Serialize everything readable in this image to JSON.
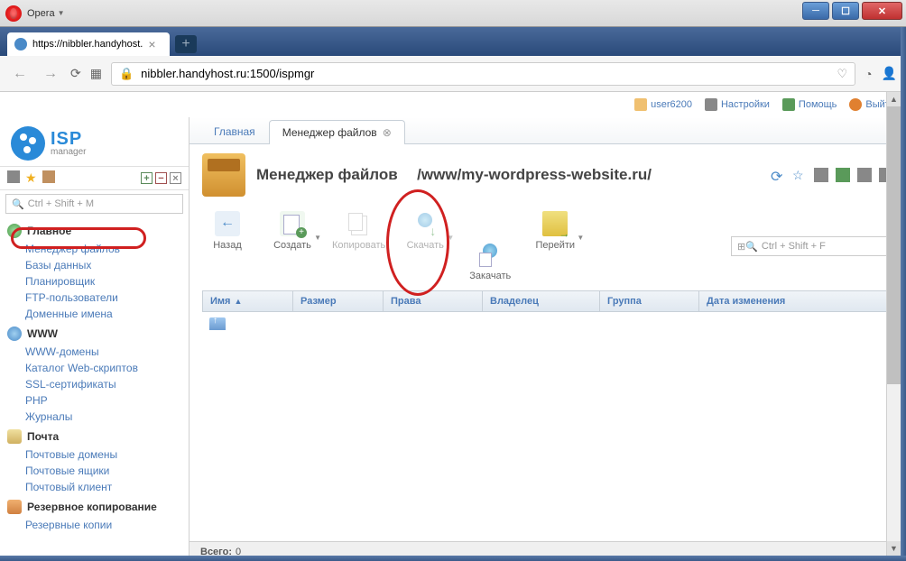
{
  "browser": {
    "name": "Opera",
    "tab_title": "https://nibbler.handyhost.",
    "url": "nibbler.handyhost.ru:1500/ispmgr"
  },
  "userbar": {
    "user": "user6200",
    "settings": "Настройки",
    "help": "Помощь",
    "exit": "Выйти"
  },
  "logo": {
    "title": "ISP",
    "subtitle": "manager"
  },
  "sidebar": {
    "search_placeholder": "Ctrl + Shift + M",
    "groups": [
      {
        "title": "Главное",
        "icon": "main",
        "items": [
          "Менеджер файлов",
          "Базы данных",
          "Планировщик",
          "FTP-пользователи",
          "Доменные имена"
        ]
      },
      {
        "title": "WWW",
        "icon": "www",
        "items": [
          "WWW-домены",
          "Каталог Web-скриптов",
          "SSL-сертификаты",
          "PHP",
          "Журналы"
        ]
      },
      {
        "title": "Почта",
        "icon": "mail",
        "items": [
          "Почтовые домены",
          "Почтовые ящики",
          "Почтовый клиент"
        ]
      },
      {
        "title": "Резервное копирование",
        "icon": "backup",
        "items": [
          "Резервные копии"
        ]
      }
    ]
  },
  "tabs": [
    {
      "label": "Главная",
      "selected": false,
      "closable": false
    },
    {
      "label": "Менеджер файлов",
      "selected": true,
      "closable": true
    }
  ],
  "page": {
    "title": "Менеджер файлов",
    "path": "/www/my-wordpress-website.ru/"
  },
  "toolbar": {
    "back": "Назад",
    "create": "Создать",
    "copy": "Копировать",
    "download": "Скачать",
    "upload": "Закачать",
    "goto": "Перейти",
    "filter_placeholder": "Ctrl + Shift + F"
  },
  "table": {
    "cols": {
      "name": "Имя",
      "size": "Размер",
      "perm": "Права",
      "owner": "Владелец",
      "group": "Группа",
      "date": "Дата изменения"
    }
  },
  "status": {
    "total_label": "Всего:",
    "total_value": "0"
  }
}
